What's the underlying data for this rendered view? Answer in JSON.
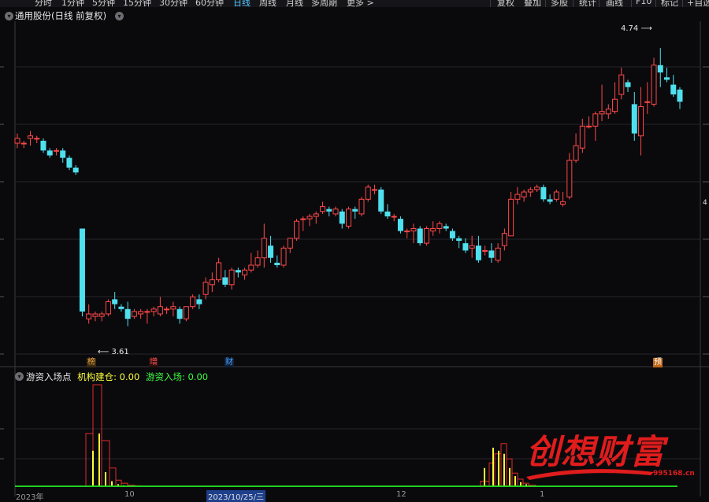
{
  "toolbar": {
    "items": [
      {
        "label": "分时",
        "active": false
      },
      {
        "label": "1分钟",
        "active": false
      },
      {
        "label": "5分钟",
        "active": false
      },
      {
        "label": "15分钟",
        "active": false
      },
      {
        "label": "30分钟",
        "active": false
      },
      {
        "label": "60分钟",
        "active": false
      },
      {
        "label": "日线",
        "active": true
      },
      {
        "label": "周线",
        "active": false
      },
      {
        "label": "月线",
        "active": false
      },
      {
        "label": "多周期",
        "active": false
      },
      {
        "label": "更多 >",
        "active": false
      }
    ],
    "right_items": [
      "复权",
      "叠加",
      "多股",
      "统计",
      "画线",
      "F10",
      "标记",
      "+自选"
    ]
  },
  "main_panel": {
    "title": "通用股份(日线 前复权)",
    "high_label": "4.74",
    "low_label": "3.61",
    "right_edge_label": "4"
  },
  "markers": [
    {
      "text": "榜",
      "color": "#e0a040",
      "bg": "#3a2a10"
    },
    {
      "text": "增",
      "color": "#ff5050",
      "bg": "#2a1010"
    },
    {
      "text": "财",
      "color": "#4aa0ff",
      "bg": "#102038"
    },
    {
      "text": "预",
      "color": "#ffffff",
      "bg": "#c06818"
    }
  ],
  "sub_panel": {
    "name": "游资入场点",
    "ind1_label": "机构建仓: 0.00",
    "ind2_label": "游资入场: 0.00"
  },
  "x_axis": {
    "labels": [
      "2023年",
      "10",
      "2023/10/25/三",
      "12",
      "1"
    ]
  },
  "watermark": {
    "text": "创想财富",
    "url": "995168.cn"
  },
  "colors": {
    "up": "#ff4848",
    "down": "#4fe0ee",
    "indicator_red": "#e02a2a",
    "indicator_yellow": "#ffff33",
    "baseline_green": "#1ed01e"
  },
  "chart_data": {
    "type": "candlestick",
    "ylim": [
      3.45,
      4.85
    ],
    "high": 4.74,
    "low": 3.61,
    "candles": [
      [
        4.35,
        4.39,
        4.33,
        4.37
      ],
      [
        4.35,
        4.36,
        4.33,
        4.35
      ],
      [
        4.37,
        4.4,
        4.34,
        4.38
      ],
      [
        4.37,
        4.38,
        4.35,
        4.37
      ],
      [
        4.36,
        4.37,
        4.31,
        4.32
      ],
      [
        4.32,
        4.33,
        4.29,
        4.3
      ],
      [
        4.32,
        4.33,
        4.3,
        4.32
      ],
      [
        4.32,
        4.33,
        4.27,
        4.29
      ],
      [
        4.29,
        4.3,
        4.24,
        4.25
      ],
      [
        4.25,
        4.26,
        4.22,
        4.23
      ],
      [
        4.0,
        4.0,
        3.64,
        3.66
      ],
      [
        3.63,
        3.69,
        3.61,
        3.65
      ],
      [
        3.64,
        3.66,
        3.62,
        3.65
      ],
      [
        3.64,
        3.66,
        3.62,
        3.65
      ],
      [
        3.65,
        3.71,
        3.64,
        3.7
      ],
      [
        3.71,
        3.74,
        3.67,
        3.69
      ],
      [
        3.68,
        3.69,
        3.66,
        3.67
      ],
      [
        3.67,
        3.7,
        3.6,
        3.63
      ],
      [
        3.64,
        3.67,
        3.63,
        3.66
      ],
      [
        3.65,
        3.67,
        3.63,
        3.66
      ],
      [
        3.66,
        3.67,
        3.61,
        3.66
      ],
      [
        3.66,
        3.68,
        3.64,
        3.67
      ],
      [
        3.65,
        3.72,
        3.64,
        3.68
      ],
      [
        3.67,
        3.68,
        3.65,
        3.67
      ],
      [
        3.67,
        3.7,
        3.64,
        3.68
      ],
      [
        3.67,
        3.68,
        3.61,
        3.63
      ],
      [
        3.63,
        3.68,
        3.62,
        3.68
      ],
      [
        3.68,
        3.73,
        3.67,
        3.72
      ],
      [
        3.71,
        3.73,
        3.67,
        3.69
      ],
      [
        3.73,
        3.8,
        3.71,
        3.78
      ],
      [
        3.77,
        3.82,
        3.74,
        3.79
      ],
      [
        3.79,
        3.88,
        3.78,
        3.86
      ],
      [
        3.8,
        3.83,
        3.76,
        3.77
      ],
      [
        3.77,
        3.84,
        3.75,
        3.83
      ],
      [
        3.83,
        3.84,
        3.8,
        3.82
      ],
      [
        3.81,
        3.84,
        3.79,
        3.83
      ],
      [
        3.83,
        3.9,
        3.82,
        3.85
      ],
      [
        3.85,
        3.91,
        3.84,
        3.88
      ],
      [
        3.88,
        4.02,
        3.84,
        3.96
      ],
      [
        3.93,
        3.97,
        3.86,
        3.88
      ],
      [
        3.86,
        3.89,
        3.84,
        3.85
      ],
      [
        3.85,
        3.93,
        3.84,
        3.92
      ],
      [
        3.92,
        3.96,
        3.9,
        3.96
      ],
      [
        3.96,
        4.04,
        3.95,
        4.03
      ],
      [
        4.04,
        4.05,
        3.99,
        4.04
      ],
      [
        4.04,
        4.06,
        4.01,
        4.05
      ],
      [
        4.05,
        4.07,
        4.02,
        4.06
      ],
      [
        4.07,
        4.11,
        4.06,
        4.09
      ],
      [
        4.08,
        4.09,
        4.05,
        4.07
      ],
      [
        4.06,
        4.09,
        4.05,
        4.08
      ],
      [
        4.07,
        4.08,
        4.0,
        4.02
      ],
      [
        4.01,
        4.09,
        4.0,
        4.08
      ],
      [
        4.08,
        4.09,
        4.04,
        4.07
      ],
      [
        4.06,
        4.13,
        4.05,
        4.12
      ],
      [
        4.12,
        4.18,
        4.11,
        4.17
      ],
      [
        4.16,
        4.18,
        4.14,
        4.16
      ],
      [
        4.16,
        4.17,
        4.06,
        4.07
      ],
      [
        4.07,
        4.1,
        4.04,
        4.05
      ],
      [
        4.05,
        4.06,
        4.03,
        4.05
      ],
      [
        4.04,
        4.05,
        3.98,
        3.99
      ],
      [
        3.99,
        4.0,
        3.96,
        3.99
      ],
      [
        3.99,
        4.02,
        3.94,
        4.0
      ],
      [
        4.0,
        4.01,
        3.93,
        3.94
      ],
      [
        3.94,
        4.01,
        3.93,
        4.0
      ],
      [
        3.99,
        4.03,
        3.97,
        4.0
      ],
      [
        4.0,
        4.03,
        3.98,
        4.02
      ],
      [
        4.01,
        4.02,
        3.99,
        4.0
      ],
      [
        3.99,
        4.0,
        3.95,
        3.96
      ],
      [
        3.96,
        3.97,
        3.92,
        3.95
      ],
      [
        3.94,
        3.96,
        3.9,
        3.91
      ],
      [
        3.92,
        3.97,
        3.88,
        3.93
      ],
      [
        3.93,
        3.97,
        3.86,
        3.87
      ],
      [
        3.91,
        3.93,
        3.89,
        3.91
      ],
      [
        3.91,
        3.94,
        3.86,
        3.88
      ],
      [
        3.87,
        3.94,
        3.86,
        3.92
      ],
      [
        3.93,
        4.0,
        3.91,
        3.98
      ],
      [
        3.97,
        4.15,
        3.97,
        4.12
      ],
      [
        4.12,
        4.17,
        4.1,
        4.14
      ],
      [
        4.13,
        4.16,
        4.11,
        4.15
      ],
      [
        4.15,
        4.17,
        4.13,
        4.16
      ],
      [
        4.16,
        4.18,
        4.15,
        4.17
      ],
      [
        4.17,
        4.18,
        4.11,
        4.12
      ],
      [
        4.12,
        4.14,
        4.1,
        4.11
      ],
      [
        4.12,
        4.16,
        4.11,
        4.15
      ],
      [
        4.1,
        4.15,
        4.09,
        4.11
      ],
      [
        4.13,
        4.31,
        4.12,
        4.28
      ],
      [
        4.28,
        4.39,
        4.27,
        4.34
      ],
      [
        4.33,
        4.45,
        4.31,
        4.42
      ],
      [
        4.42,
        4.46,
        4.41,
        4.42
      ],
      [
        4.42,
        4.48,
        4.36,
        4.47
      ],
      [
        4.47,
        4.59,
        4.44,
        4.48
      ],
      [
        4.47,
        4.51,
        4.45,
        4.49
      ],
      [
        4.48,
        4.6,
        4.47,
        4.53
      ],
      [
        4.55,
        4.66,
        4.53,
        4.63
      ],
      [
        4.6,
        4.61,
        4.56,
        4.58
      ],
      [
        4.51,
        4.56,
        4.36,
        4.39
      ],
      [
        4.38,
        4.58,
        4.3,
        4.5
      ],
      [
        4.52,
        4.6,
        4.47,
        4.52
      ],
      [
        4.51,
        4.7,
        4.5,
        4.67
      ],
      [
        4.67,
        4.74,
        4.58,
        4.64
      ],
      [
        4.62,
        4.66,
        4.6,
        4.61
      ],
      [
        4.59,
        4.63,
        4.54,
        4.55
      ],
      [
        4.57,
        4.58,
        4.49,
        4.52
      ]
    ],
    "indicator": {
      "red_bars": [
        [
          109,
          0.52
        ],
        [
          118,
          1.0
        ],
        [
          129,
          0.45
        ],
        [
          139,
          0.18
        ],
        [
          147,
          0.06
        ],
        [
          154,
          0.03
        ],
        [
          162,
          0.01
        ],
        [
          171,
          0.005
        ],
        [
          610,
          0.05
        ],
        [
          621,
          0.23
        ],
        [
          628,
          0.32
        ],
        [
          636,
          0.42
        ],
        [
          643,
          0.27
        ],
        [
          650,
          0.13
        ],
        [
          657,
          0.07
        ],
        [
          664,
          0.03
        ],
        [
          671,
          0.01
        ]
      ],
      "yellow_bars": [
        [
          117,
          0.35
        ],
        [
          125,
          0.52
        ],
        [
          133,
          0.14
        ],
        [
          141,
          0.05
        ],
        [
          149,
          0.02
        ],
        [
          156,
          0.01
        ],
        [
          614,
          0.18
        ],
        [
          625,
          0.38
        ],
        [
          632,
          0.35
        ],
        [
          639,
          0.32
        ],
        [
          646,
          0.18
        ],
        [
          653,
          0.1
        ],
        [
          660,
          0.04
        ],
        [
          667,
          0.02
        ]
      ]
    }
  }
}
